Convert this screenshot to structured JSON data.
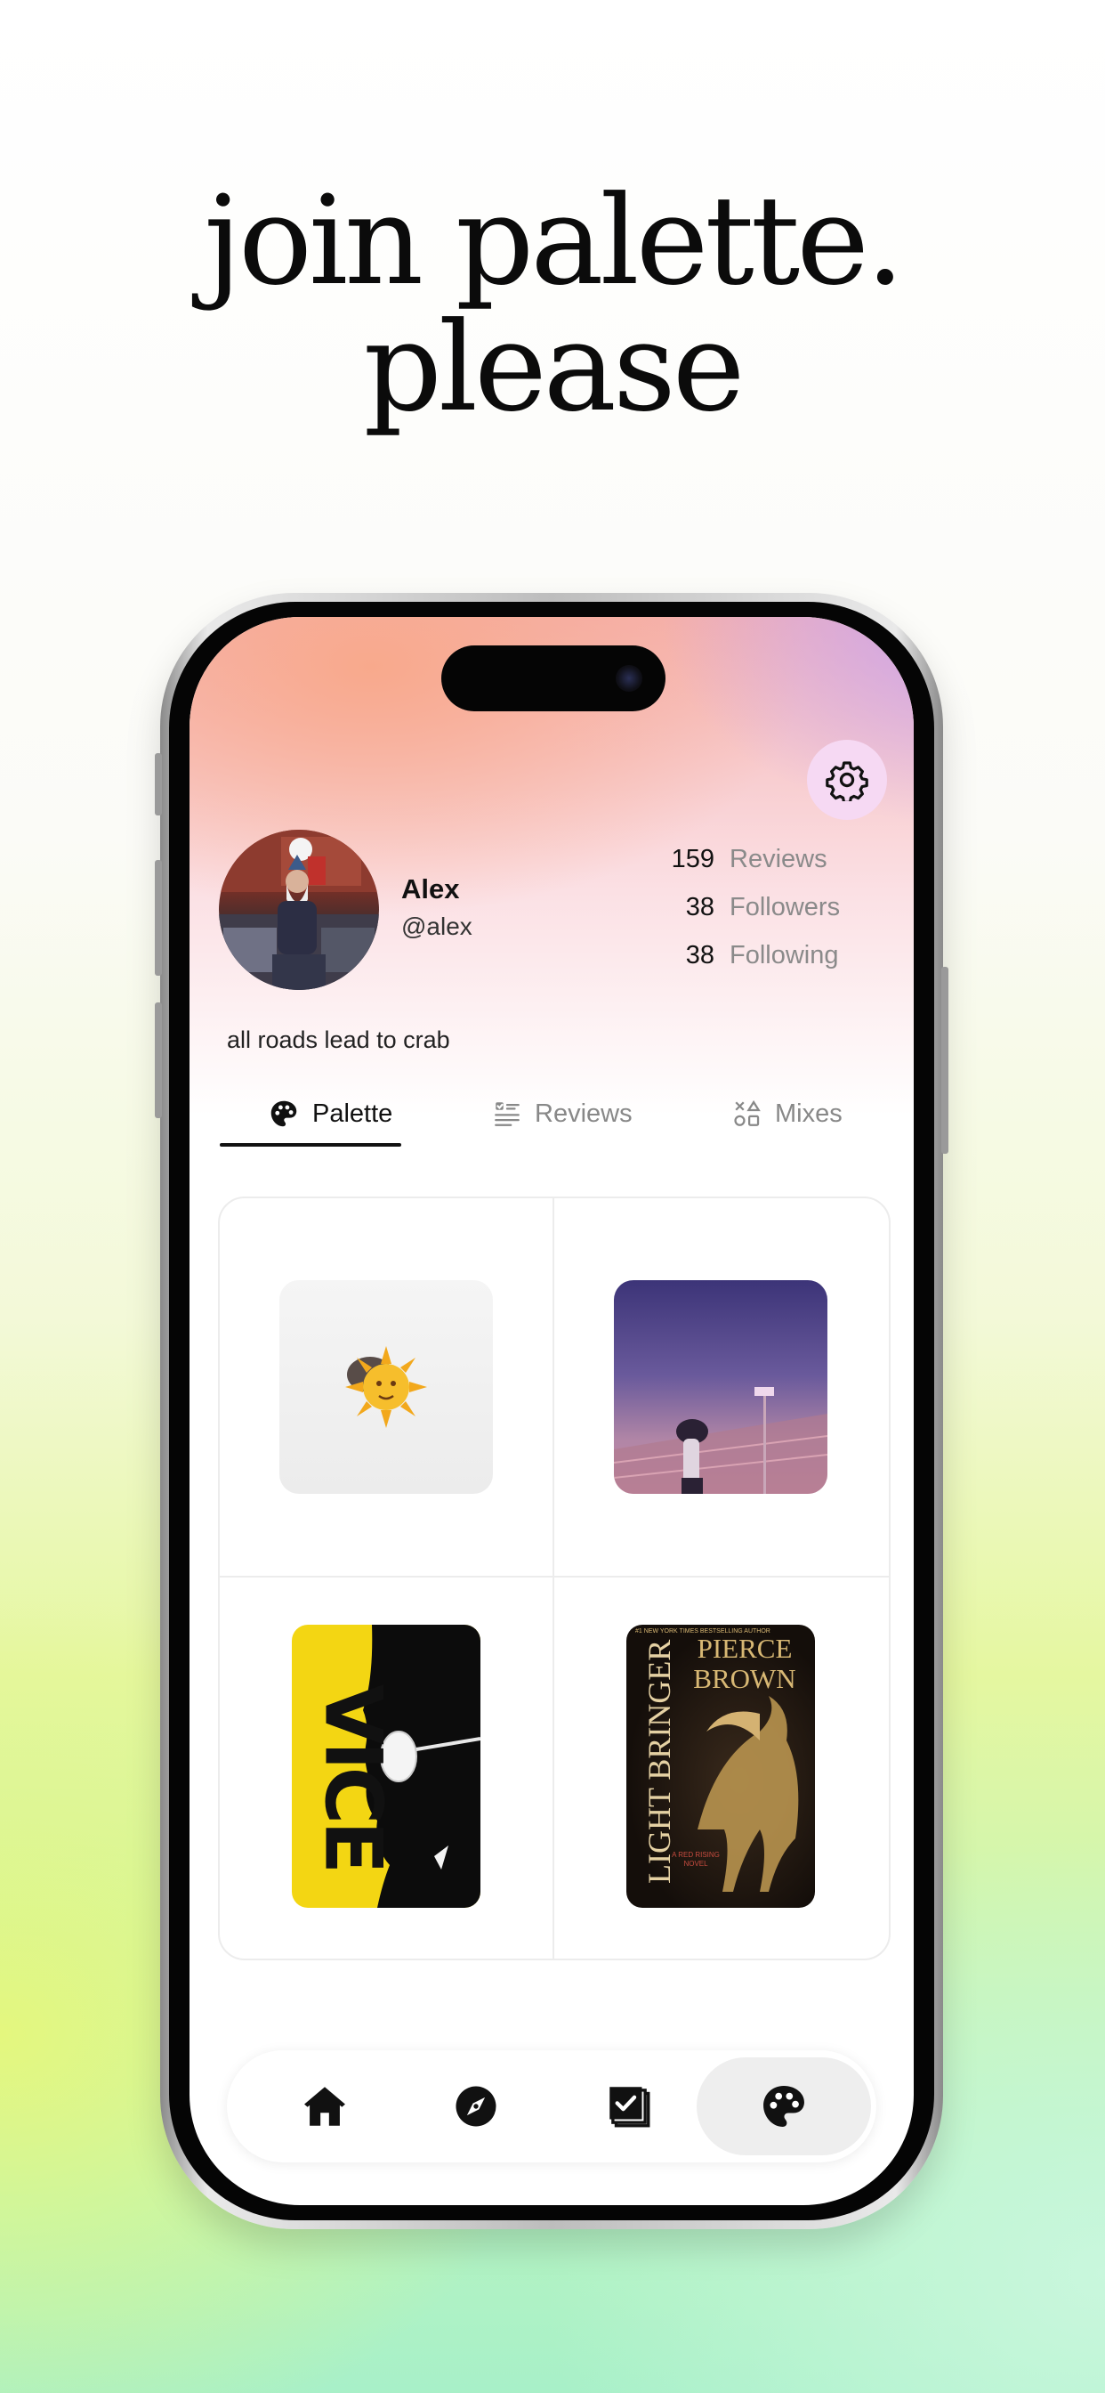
{
  "headline": {
    "line1": "join palette.",
    "line2": "please"
  },
  "profile": {
    "name": "Alex",
    "handle": "@alex",
    "bio": "all roads lead to crab",
    "stats": [
      {
        "value": "159",
        "label": "Reviews"
      },
      {
        "value": "38",
        "label": "Followers"
      },
      {
        "value": "38",
        "label": "Following"
      }
    ]
  },
  "tabs": [
    {
      "label": "Palette",
      "icon": "palette-icon",
      "active": true
    },
    {
      "label": "Reviews",
      "icon": "list-check-icon",
      "active": false
    },
    {
      "label": "Mixes",
      "icon": "shapes-icon",
      "active": false
    }
  ],
  "grid": {
    "vice_title": "VICE",
    "book_top": "#1 NEW YORK TIMES BESTSELLING AUTHOR",
    "book_author_line1": "PIERCE",
    "book_author_line2": "BROWN",
    "book_title": "LIGHT BRINGER",
    "book_sub": "A RED RISING NOVEL"
  },
  "nav": {
    "items": [
      "home-icon",
      "compass-icon",
      "checklist-stack-icon",
      "palette-icon"
    ],
    "active_index": 3
  },
  "colors": {
    "accent_settings_bg": "#f6d9f3",
    "tab_underline": "#111111"
  }
}
